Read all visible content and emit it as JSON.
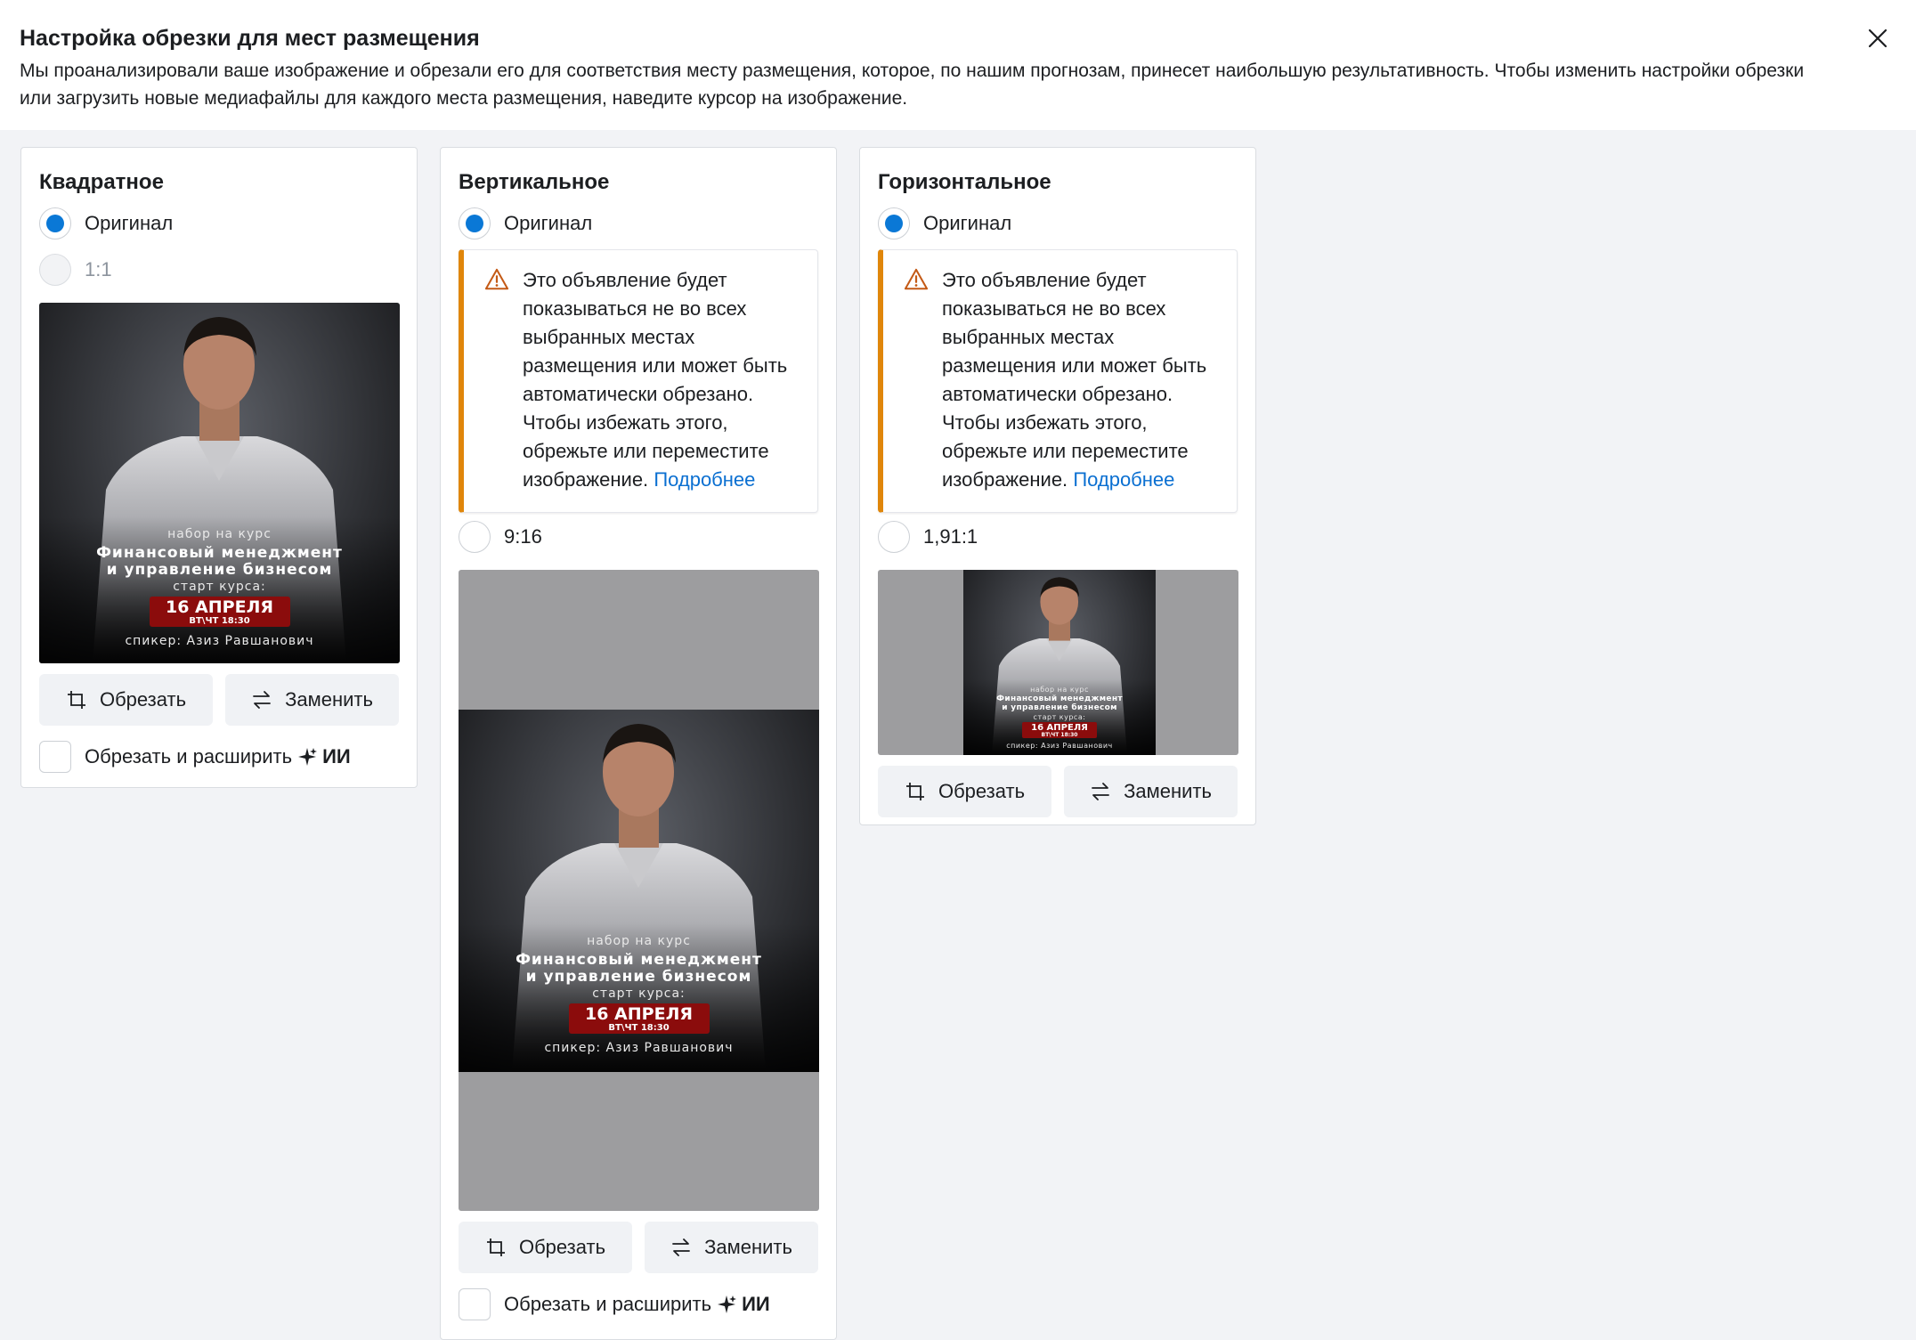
{
  "dialog": {
    "title": "Настройка обрезки для мест размещения",
    "description": "Мы проанализировали ваше изображение и обрезали его для соответствия месту размещения, которое, по нашим прогнозам, принесет наибольшую результативность. Чтобы изменить настройки обрезки или загрузить новые медиафайлы для каждого места размещения, наведите курсор на изображение."
  },
  "poster": {
    "line1": "набор на курс",
    "line2": "Финансовый менеджмент",
    "line3": "и управление бизнесом",
    "line4": "старт курса:",
    "date": "16 АПРЕЛЯ",
    "time": "ВТ\\ЧТ 18:30",
    "speaker": "спикер: Азиз Равшанович"
  },
  "cards": {
    "square": {
      "title": "Квадратное",
      "option_original": "Оригинал",
      "option_ratio": "1:1",
      "crop_label": "Обрезать",
      "replace_label": "Заменить",
      "expand_label": "Обрезать и расширить",
      "ai_label": "ИИ"
    },
    "vertical": {
      "title": "Вертикальное",
      "option_original": "Оригинал",
      "warning_text": "Это объявление будет показываться не во всех выбранных местах размещения или может быть автоматически обрезано. Чтобы избежать этого, обрежьте или переместите изображение.",
      "warning_link": "Подробнее",
      "option_ratio": "9:16",
      "crop_label": "Обрезать",
      "replace_label": "Заменить",
      "expand_label": "Обрезать и расширить",
      "ai_label": "ИИ"
    },
    "horizontal": {
      "title": "Горизонтальное",
      "option_original": "Оригинал",
      "warning_text": "Это объявление будет показываться не во всех выбранных местах размещения или может быть автоматически обрезано. Чтобы избежать этого, обрежьте или переместите изображение.",
      "warning_link": "Подробнее",
      "option_ratio": "1,91:1",
      "crop_label": "Обрезать",
      "replace_label": "Заменить"
    }
  },
  "colors": {
    "accent": "#0a78d6",
    "warning": "#e0860a",
    "date_badge": "#8b0c0c"
  }
}
